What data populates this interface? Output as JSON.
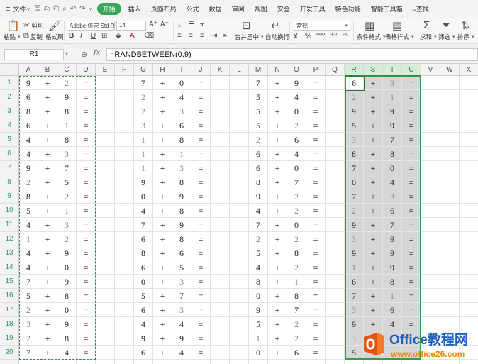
{
  "menubar": {
    "file": "文件",
    "tabs": [
      "开始",
      "插入",
      "页面布局",
      "公式",
      "数据",
      "审阅",
      "视图",
      "安全",
      "开发工具",
      "特色功能",
      "智能工具箱"
    ],
    "active_tab": "开始",
    "search": "查找"
  },
  "ribbon": {
    "paste": "粘贴",
    "cut": "剪切",
    "copy": "复制",
    "format_painter": "格式刷",
    "font_name": "Adobe 仿宋 Std R",
    "font_size": "14",
    "bold": "B",
    "italic": "I",
    "underline": "U",
    "merge_center": "合并居中",
    "wrap_text": "自动换行",
    "number_format": "常规",
    "conditional_format": "条件格式",
    "table_style": "表格样式",
    "sum": "求和",
    "filter": "筛选",
    "sort": "排序"
  },
  "formula_bar": {
    "name_box": "R1",
    "fx_label": "fx",
    "formula": "=RANDBETWEEN(0,9)"
  },
  "columns": [
    "A",
    "B",
    "C",
    "D",
    "E",
    "F",
    "G",
    "H",
    "I",
    "J",
    "K",
    "L",
    "M",
    "N",
    "O",
    "P",
    "Q",
    "R",
    "S",
    "T",
    "U",
    "V",
    "W",
    "X"
  ],
  "selected_columns": [
    "R",
    "S",
    "T",
    "U"
  ],
  "rows": [
    [
      "9",
      "+",
      "2",
      "=",
      "",
      "",
      "7",
      "+",
      "0",
      "=",
      "",
      "",
      "7",
      "+",
      "9",
      "=",
      "",
      "6",
      "+",
      "3",
      "="
    ],
    [
      "6",
      "+",
      "9",
      "=",
      "",
      "",
      "2",
      "+",
      "4",
      "=",
      "",
      "",
      "5",
      "+",
      "4",
      "=",
      "",
      "2",
      "+",
      "1",
      "="
    ],
    [
      "8",
      "+",
      "8",
      "=",
      "",
      "",
      "2",
      "+",
      "3",
      "=",
      "",
      "",
      "5",
      "+",
      "0",
      "=",
      "",
      "9",
      "+",
      "9",
      "="
    ],
    [
      "6",
      "+",
      "1",
      "=",
      "",
      "",
      "3",
      "+",
      "6",
      "=",
      "",
      "",
      "5",
      "+",
      "2",
      "=",
      "",
      "5",
      "+",
      "9",
      "="
    ],
    [
      "4",
      "+",
      "8",
      "=",
      "",
      "",
      "1",
      "+",
      "8",
      "=",
      "",
      "",
      "2",
      "+",
      "6",
      "=",
      "",
      "3",
      "+",
      "7",
      "="
    ],
    [
      "4",
      "+",
      "3",
      "=",
      "",
      "",
      "1",
      "+",
      "1",
      "=",
      "",
      "",
      "6",
      "+",
      "4",
      "=",
      "",
      "8",
      "+",
      "8",
      "="
    ],
    [
      "9",
      "+",
      "7",
      "=",
      "",
      "",
      "1",
      "+",
      "3",
      "=",
      "",
      "",
      "6",
      "+",
      "0",
      "=",
      "",
      "7",
      "+",
      "0",
      "="
    ],
    [
      "2",
      "+",
      "5",
      "=",
      "",
      "",
      "9",
      "+",
      "8",
      "=",
      "",
      "",
      "8",
      "+",
      "7",
      "=",
      "",
      "0",
      "+",
      "4",
      "="
    ],
    [
      "8",
      "+",
      "2",
      "=",
      "",
      "",
      "0",
      "+",
      "9",
      "=",
      "",
      "",
      "9",
      "+",
      "2",
      "=",
      "",
      "7",
      "+",
      "3",
      "="
    ],
    [
      "5",
      "+",
      "1",
      "=",
      "",
      "",
      "4",
      "+",
      "8",
      "=",
      "",
      "",
      "4",
      "+",
      "2",
      "=",
      "",
      "2",
      "+",
      "6",
      "="
    ],
    [
      "4",
      "+",
      "3",
      "=",
      "",
      "",
      "7",
      "+",
      "9",
      "=",
      "",
      "",
      "7",
      "+",
      "0",
      "=",
      "",
      "9",
      "+",
      "7",
      "="
    ],
    [
      "1",
      "+",
      "2",
      "=",
      "",
      "",
      "6",
      "+",
      "8",
      "=",
      "",
      "",
      "2",
      "+",
      "2",
      "=",
      "",
      "3",
      "+",
      "9",
      "="
    ],
    [
      "4",
      "+",
      "9",
      "=",
      "",
      "",
      "8",
      "+",
      "6",
      "=",
      "",
      "",
      "5",
      "+",
      "8",
      "=",
      "",
      "9",
      "+",
      "9",
      "="
    ],
    [
      "4",
      "+",
      "0",
      "=",
      "",
      "",
      "6",
      "+",
      "5",
      "=",
      "",
      "",
      "4",
      "+",
      "2",
      "=",
      "",
      "1",
      "+",
      "9",
      "="
    ],
    [
      "7",
      "+",
      "9",
      "=",
      "",
      "",
      "0",
      "+",
      "3",
      "=",
      "",
      "",
      "8",
      "+",
      "1",
      "=",
      "",
      "6",
      "+",
      "8",
      "="
    ],
    [
      "5",
      "+",
      "8",
      "=",
      "",
      "",
      "5",
      "+",
      "7",
      "=",
      "",
      "",
      "0",
      "+",
      "8",
      "=",
      "",
      "7",
      "+",
      "1",
      "="
    ],
    [
      "2",
      "+",
      "0",
      "=",
      "",
      "",
      "6",
      "+",
      "3",
      "=",
      "",
      "",
      "9",
      "+",
      "7",
      "=",
      "",
      "3",
      "+",
      "6",
      "="
    ],
    [
      "3",
      "+",
      "9",
      "=",
      "",
      "",
      "4",
      "+",
      "4",
      "=",
      "",
      "",
      "5",
      "+",
      "2",
      "=",
      "",
      "9",
      "+",
      "4",
      "="
    ],
    [
      "2",
      "+",
      "8",
      "=",
      "",
      "",
      "9",
      "+",
      "9",
      "=",
      "",
      "",
      "1",
      "+",
      "2",
      "=",
      "",
      "3",
      "+",
      "",
      ""
    ],
    [
      "7",
      "+",
      "4",
      "=",
      "",
      "",
      "6",
      "+",
      "4",
      "=",
      "",
      "",
      "0",
      "+",
      "6",
      "=",
      "",
      "5",
      "",
      "",
      ""
    ]
  ],
  "watermark": {
    "title": "Office教程网",
    "url": "www.office26.com"
  },
  "colors": {
    "accent": "#3aa65a",
    "selection_border": "#3a9a48",
    "watermark_blue": "#1f5fbf",
    "watermark_orange": "#f08a00"
  }
}
